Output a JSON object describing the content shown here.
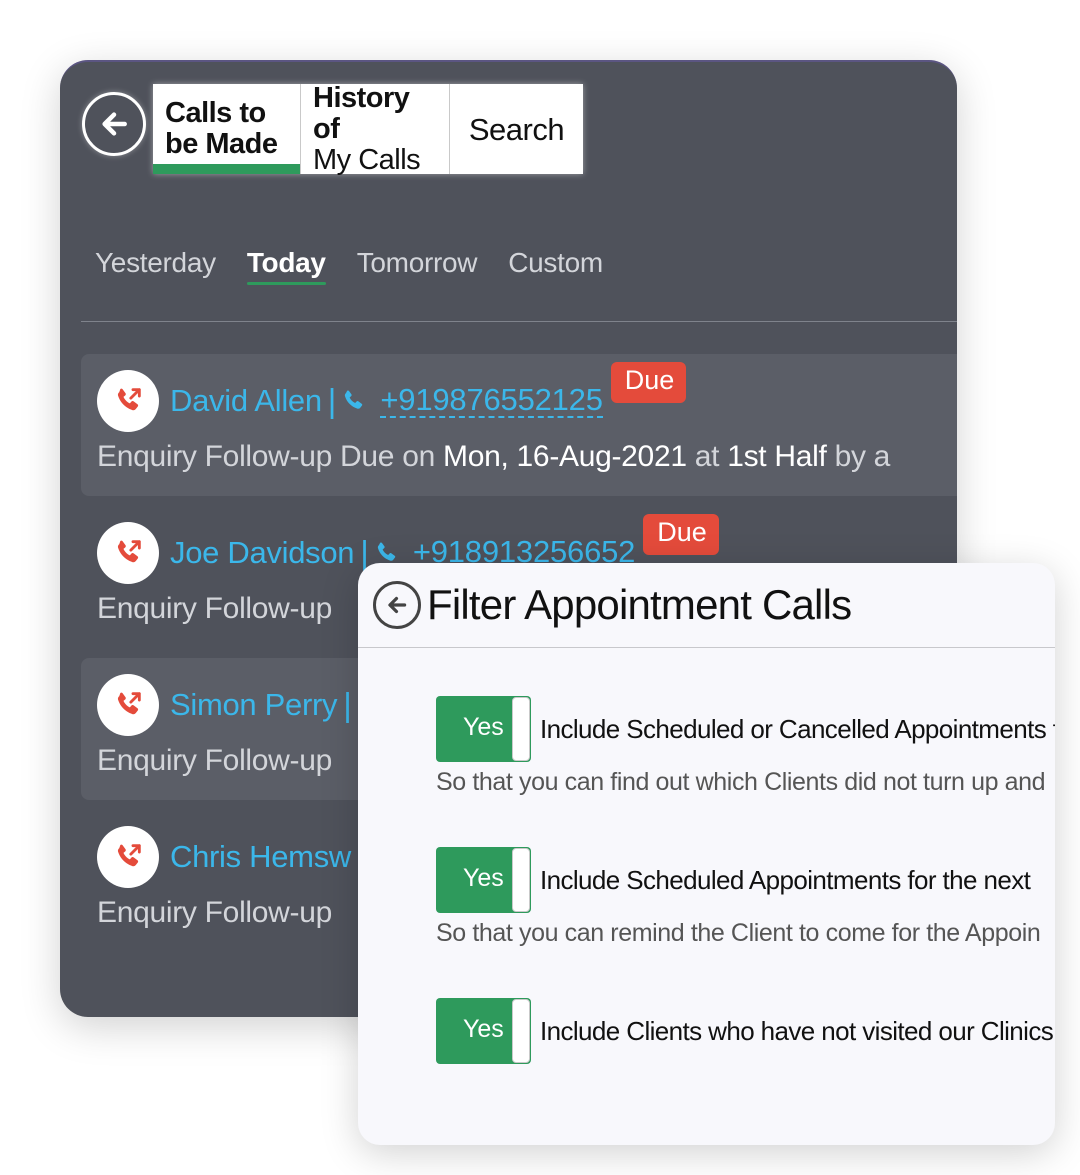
{
  "calls_panel": {
    "tabs": [
      {
        "label_line1": "Calls to",
        "label_line2": "be Made",
        "active": true
      },
      {
        "label_line1": "History of",
        "label_line2": "My Calls",
        "active": false
      },
      {
        "label": "Search",
        "active": false
      }
    ],
    "day_filters": [
      {
        "label": "Yesterday",
        "active": false
      },
      {
        "label": "Today",
        "active": true
      },
      {
        "label": "Tomorrow",
        "active": false
      },
      {
        "label": "Custom",
        "active": false
      }
    ],
    "calls": [
      {
        "name": "David Allen",
        "separator": "|",
        "phone": "+919876552125",
        "badge": "Due",
        "desc_prefix": "Enquiry Follow-up Due on ",
        "desc_date": "Mon, 16-Aug-2021",
        "desc_mid": " at ",
        "desc_slot": "1st Half",
        "desc_suffix": " by a"
      },
      {
        "name": "Joe Davidson",
        "separator": "|",
        "phone": "+918913256652",
        "badge": "Due",
        "desc_prefix": "Enquiry Follow-up"
      },
      {
        "name": "Simon Perry",
        "separator": "|",
        "desc_prefix": "Enquiry Follow-up"
      },
      {
        "name": "Chris Hemsw",
        "desc_prefix": "Enquiry Follow-up"
      }
    ]
  },
  "filter_panel": {
    "title": "Filter Appointment Calls",
    "options": [
      {
        "toggle_label": "Yes",
        "label": "Include Scheduled or Cancelled Appointments f",
        "description": "So that you can find out which Clients did not turn up and"
      },
      {
        "toggle_label": "Yes",
        "label": "Include Scheduled Appointments for the next",
        "description": "So that you can remind the Client to come for the Appoin",
        "input_value": ""
      },
      {
        "toggle_label": "Yes",
        "label": "Include Clients who have not visited our Clinics",
        "description": ""
      }
    ]
  },
  "colors": {
    "panel_dark": "#4f525b",
    "accent_green": "#2e9a5c",
    "link_blue": "#3bb7ea",
    "due_red": "#e44b3b"
  }
}
